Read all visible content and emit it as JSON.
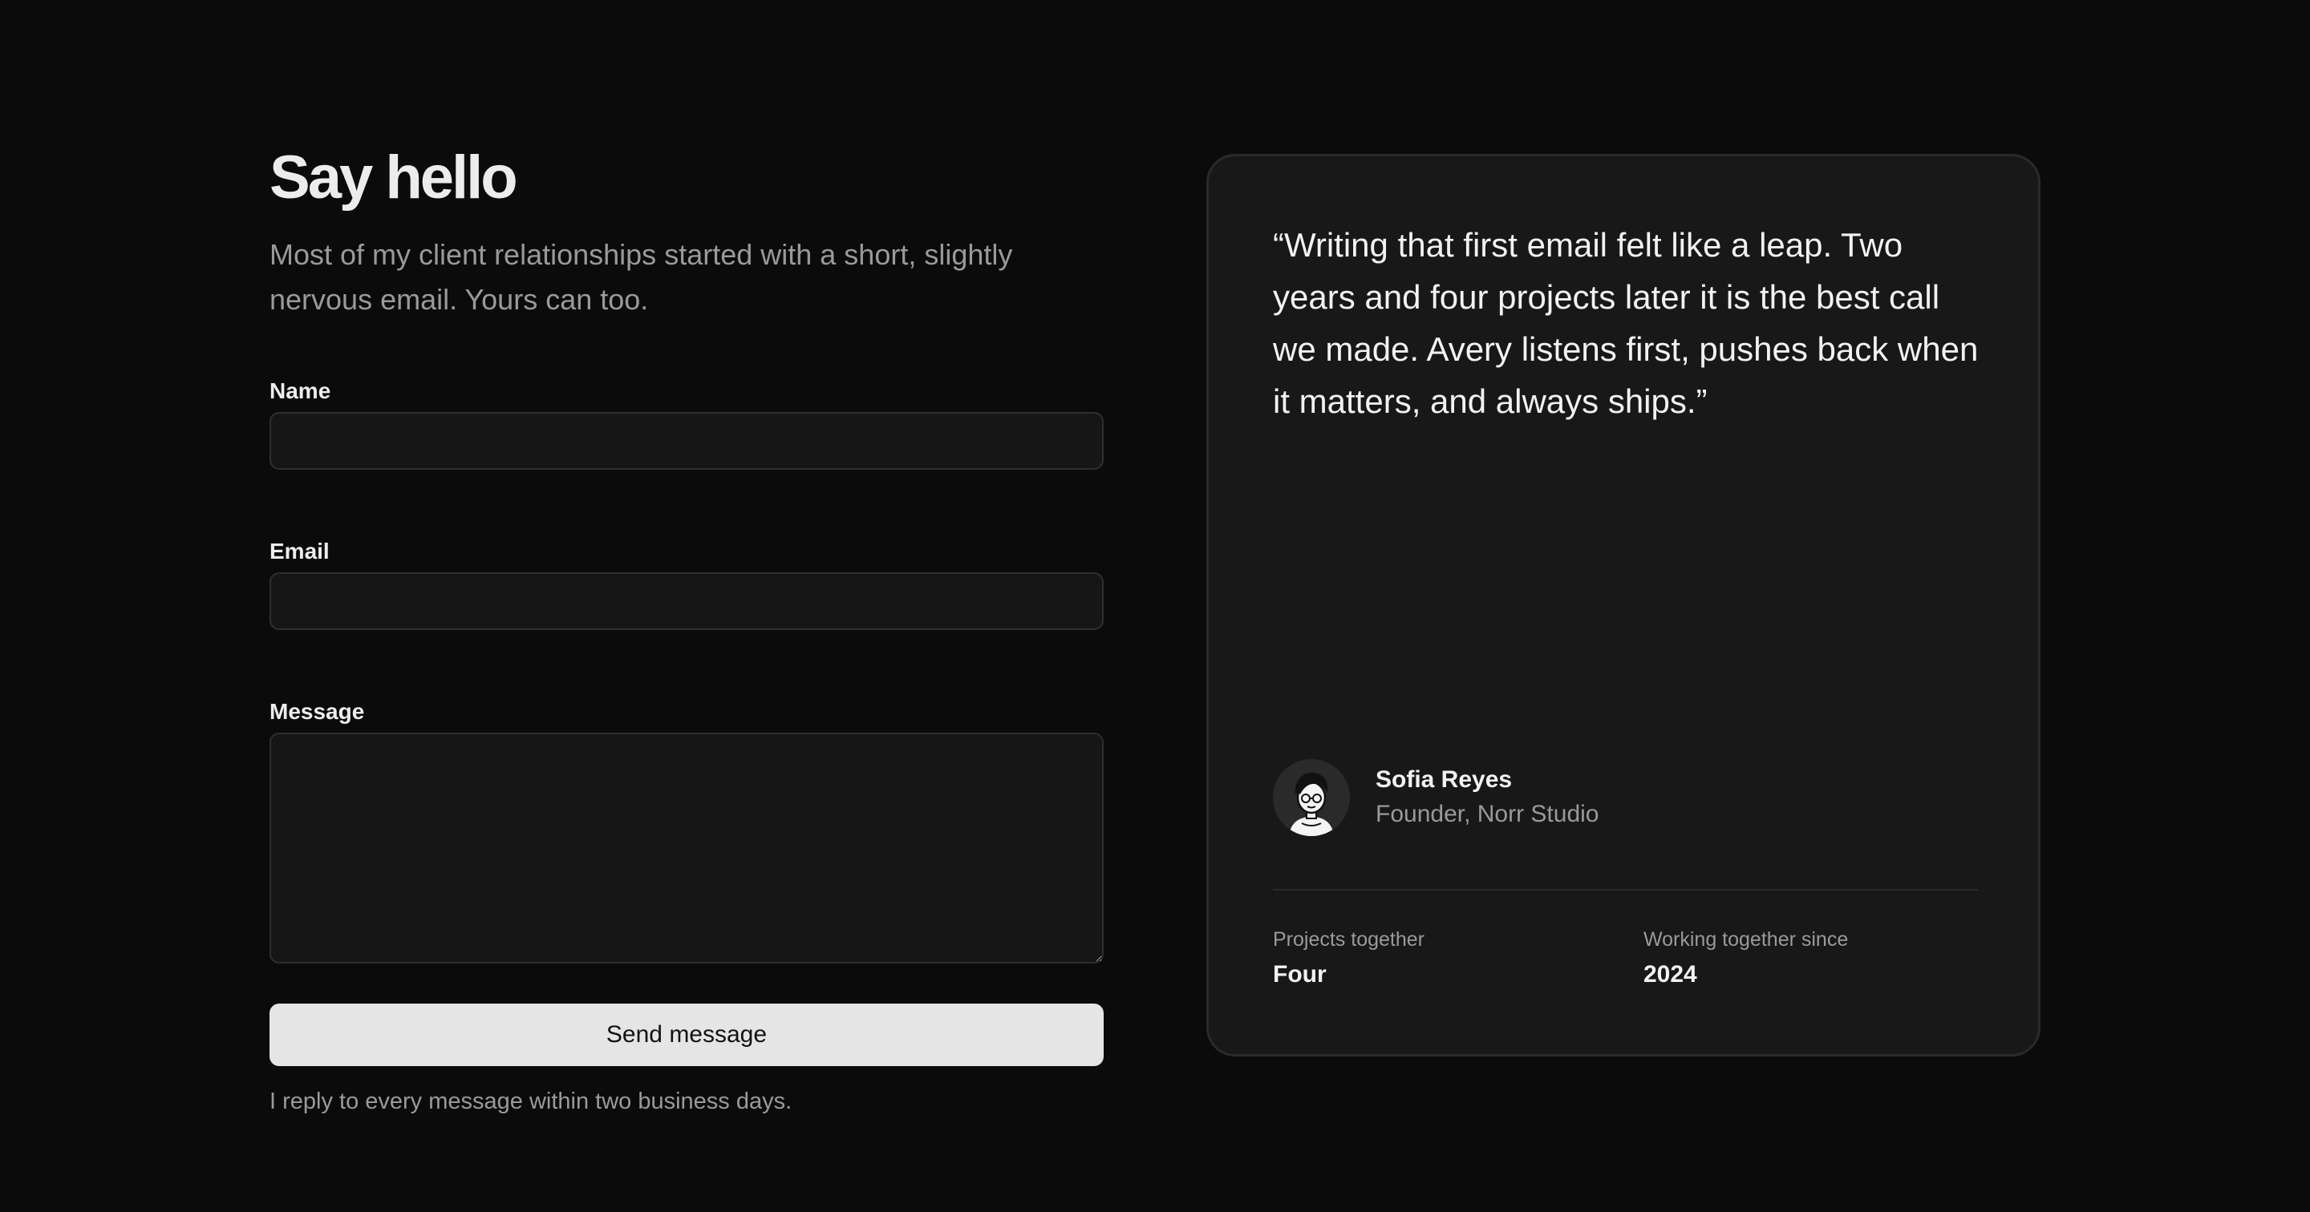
{
  "contact": {
    "title": "Say hello",
    "subtitle": "Most of my client relationships started with a short, slightly nervous email. Yours can too.",
    "fields": {
      "name_label": "Name",
      "name_value": "",
      "email_label": "Email",
      "email_value": "",
      "message_label": "Message",
      "message_value": ""
    },
    "send_label": "Send message",
    "reply_note": "I reply to every message within two business days."
  },
  "testimonial": {
    "quote": "“Writing that first email felt like a leap. Two years and four projects later it is the best call we made. Avery listens first, pushes back when it matters, and always ships.”",
    "author": {
      "name": "Sofia Reyes",
      "role": "Founder, Norr Studio",
      "avatar_icon": "avatar-illustration-icon"
    },
    "stats": [
      {
        "label": "Projects together",
        "value": "Four"
      },
      {
        "label": "Working together since",
        "value": "2024"
      }
    ]
  },
  "colors": {
    "background": "#0b0b0b",
    "card": "#181818",
    "field": "#161616",
    "button": "#e5e5e5",
    "muted_text": "#9a9a9a"
  }
}
